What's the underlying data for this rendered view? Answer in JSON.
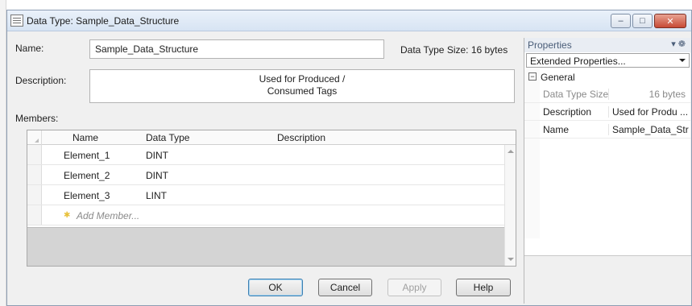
{
  "window": {
    "title": "Data Type: Sample_Data_Structure"
  },
  "form": {
    "name_label": "Name:",
    "name_value": "Sample_Data_Structure",
    "size_label": "Data Type Size: 16 bytes",
    "description_label": "Description:",
    "description_line1": "Used for Produced /",
    "description_line2": "Consumed Tags",
    "members_label": "Members:"
  },
  "members": {
    "columns": [
      "Name",
      "Data Type",
      "Description"
    ],
    "rows": [
      {
        "name": "Element_1",
        "type": "DINT",
        "description": ""
      },
      {
        "name": "Element_2",
        "type": "DINT",
        "description": ""
      },
      {
        "name": "Element_3",
        "type": "LINT",
        "description": ""
      }
    ],
    "add_label": "Add Member..."
  },
  "buttons": {
    "ok": "OK",
    "cancel": "Cancel",
    "apply": "Apply",
    "help": "Help"
  },
  "properties": {
    "title": "Properties",
    "pin_icons": "▾ ❁",
    "selector": "Extended Properties...",
    "category": "General",
    "category_toggle": "−",
    "rows": [
      {
        "key": "Data Type Size",
        "value": "16 bytes",
        "readonly": true
      },
      {
        "key": "Description",
        "value": "Used for Produ ...",
        "readonly": false
      },
      {
        "key": "Name",
        "value": "Sample_Data_Stru",
        "readonly": false
      }
    ]
  },
  "titlebar_buttons": {
    "minimize": "‒",
    "maximize": "□",
    "close": "✕"
  }
}
